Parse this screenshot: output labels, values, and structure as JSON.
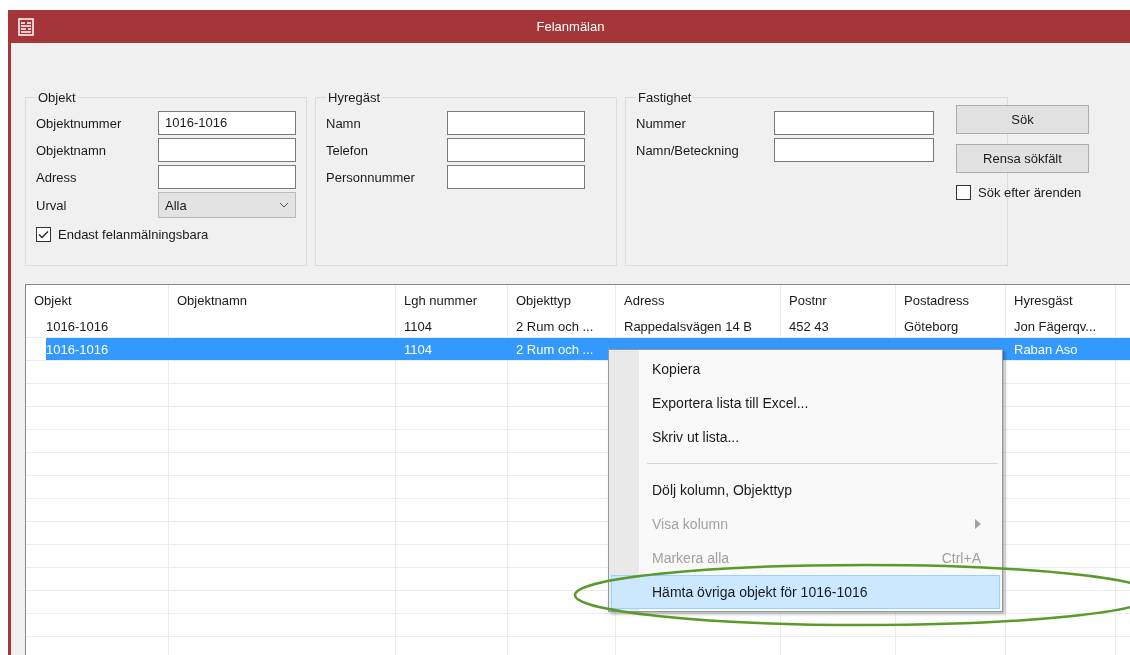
{
  "window": {
    "title": "Felanmälan"
  },
  "objekt_group": {
    "legend": "Objekt",
    "fields": [
      {
        "label": "Objektnummer",
        "value": "1016-1016"
      },
      {
        "label": "Objektnamn"
      },
      {
        "label": "Adress"
      }
    ],
    "urval": {
      "label": "Urval",
      "value": "Alla"
    },
    "checkbox": {
      "label": "Endast felanmälningsbara",
      "checked": true
    }
  },
  "hyresgast_group": {
    "legend": "Hyregäst",
    "fields": [
      {
        "label": "Namn"
      },
      {
        "label": "Telefon"
      },
      {
        "label": "Personnummer"
      }
    ]
  },
  "fastighet_group": {
    "legend": "Fastighet",
    "fields": [
      {
        "label": "Nummer"
      },
      {
        "label": "Namn/Beteckning"
      }
    ]
  },
  "buttons": [
    "Sök",
    "Rensa sökfält"
  ],
  "search_cases": {
    "label": "Sök efter ärenden",
    "checked": false
  },
  "table": {
    "columns": [
      "Objekt",
      "Objektnamn",
      "Lgh nummer",
      "Objekttyp",
      "Adress",
      "Postnr",
      "Postadress",
      "Hyresgäst"
    ],
    "rows": [
      {
        "selected": false,
        "cells": [
          "1016-1016",
          null,
          "1104",
          "2 Rum och ...",
          "Rappedalsvägen 14 B",
          "452 43",
          "Göteborg",
          "Jon Fägerqv..."
        ]
      },
      {
        "selected": true,
        "cells": [
          "1016-1016",
          null,
          "1104",
          "2 Rum och ...",
          null,
          null,
          null,
          "Raban Aso"
        ]
      }
    ]
  },
  "context_menu": {
    "items": [
      {
        "kind": "item",
        "label": "Kopiera",
        "disabled": false,
        "highlighted": false
      },
      {
        "kind": "item",
        "label": "Exportera lista till Excel...",
        "disabled": false,
        "highlighted": false
      },
      {
        "kind": "item",
        "label": "Skriv ut lista...",
        "disabled": false,
        "highlighted": false
      },
      {
        "kind": "separator"
      },
      {
        "kind": "item",
        "label": "Dölj kolumn, Objekttyp",
        "disabled": false,
        "highlighted": false
      },
      {
        "kind": "submenu",
        "label": "Visa kolumn",
        "disabled": true,
        "highlighted": false
      },
      {
        "kind": "item",
        "label": "Markera alla",
        "shortcut": "Ctrl+A",
        "disabled": true,
        "highlighted": false
      },
      {
        "kind": "item",
        "label": "Hämta övriga objekt för 1016-1016",
        "disabled": false,
        "highlighted": true
      }
    ]
  }
}
